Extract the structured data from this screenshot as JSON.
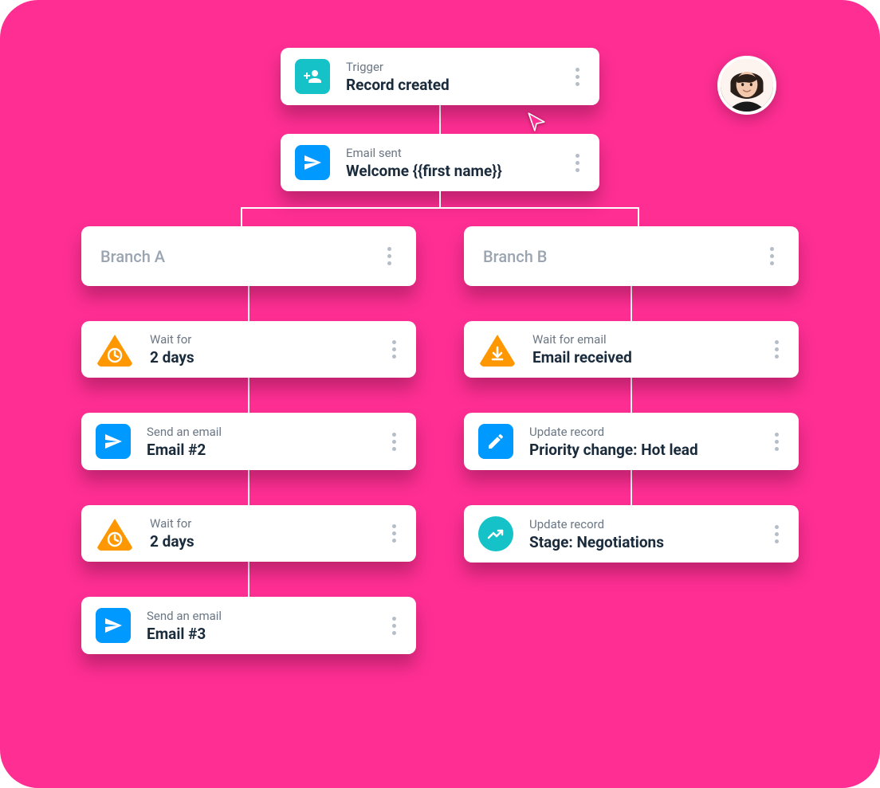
{
  "workflow": {
    "trigger": {
      "label": "Trigger",
      "title": "Record created"
    },
    "step1": {
      "label": "Email sent",
      "title": "Welcome {{first name}}"
    },
    "branchA": {
      "name": "Branch A",
      "steps": [
        {
          "label": "Wait for",
          "title": "2 days"
        },
        {
          "label": "Send an email",
          "title": "Email #2"
        },
        {
          "label": "Wait for",
          "title": "2 days"
        },
        {
          "label": "Send an email",
          "title": "Email #3"
        }
      ]
    },
    "branchB": {
      "name": "Branch B",
      "steps": [
        {
          "label": "Wait for email",
          "title": "Email received"
        },
        {
          "label": "Update record",
          "title": "Priority change: Hot lead"
        },
        {
          "label": "Update record",
          "title": "Stage: Negotiations"
        }
      ]
    }
  }
}
